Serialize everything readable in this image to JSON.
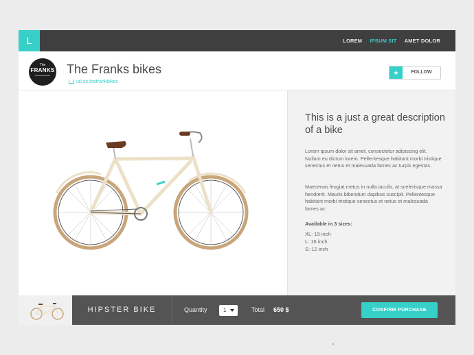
{
  "topbar": {
    "logo_letter": "L",
    "nav": [
      {
        "label": "LOREM",
        "active": false
      },
      {
        "label": "IPSUM SIT",
        "active": true
      },
      {
        "label": "AMET DOLOR",
        "active": false
      }
    ]
  },
  "brand": {
    "logo_line1": "The",
    "logo_line2": "FRANKS",
    "name": "The Franks bikes",
    "url": "url.co.thefrankbikes",
    "follow_label": "FOLLOW"
  },
  "product": {
    "headline": "This is a just a great description of a bike",
    "paragraph1": "Lorem ipsum dolor sit amet, consectetur adipiscing elit. Nullam eu dictum lorem. Pellentesque habitant morbi tristique senectus et netus et malesuada fames ac turpis egestas.",
    "paragraph2": "Maecenas feugiat metus in nulla iaculis, at scelerisque massa hendrerit. Mauris bibendum dapibus suscipit. Pellentesque habitant morbi tristique senectus et netus et malesuada fames ac",
    "sizes_title": "Available in 3 sizes:",
    "sizes": [
      "XL: 19 inch",
      "L: 16 inch",
      "S: 12 inch"
    ]
  },
  "footer": {
    "product_name": "HIPSTER BIKE",
    "quantity_label": "Quantity",
    "quantity_value": "1",
    "total_label": "Total",
    "total_value": "650 $",
    "confirm_label": "CONFIRM PURCHASE"
  },
  "colors": {
    "accent": "#37d0c8",
    "topbar": "#3f3f3f",
    "footer": "#545454"
  }
}
